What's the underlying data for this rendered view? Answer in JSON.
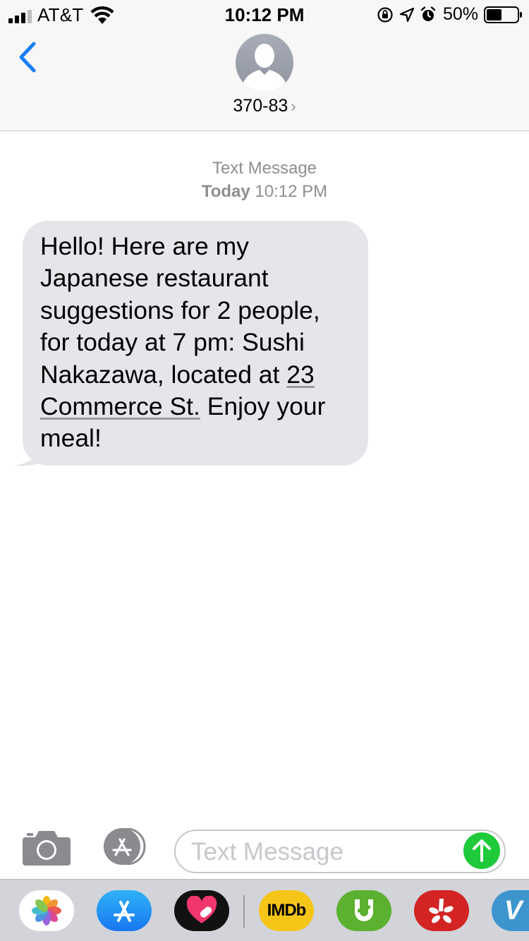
{
  "status_bar": {
    "carrier": "AT&T",
    "time": "10:12 PM",
    "battery_percent": "50%",
    "battery_level": 0.5,
    "icons": [
      "signal-bars-icon",
      "wifi-icon",
      "orientation-lock-icon",
      "location-arrow-icon",
      "alarm-clock-icon",
      "battery-icon"
    ]
  },
  "header": {
    "back_icon": "chevron-left-icon",
    "avatar_icon": "person-silhouette-icon",
    "contact_name": "370-83",
    "contact_chevron": "›"
  },
  "conversation": {
    "service": "Text Message",
    "day": "Today",
    "time": "10:12 PM",
    "messages": [
      {
        "direction": "incoming",
        "text_before": "Hello! Here are my Japanese restaurant suggestions for 2 people, for today at 7 pm: Sushi Nakazawa, located at ",
        "address_link": "23 Commerce St.",
        "text_after": " Enjoy your meal!"
      }
    ]
  },
  "compose": {
    "camera_icon": "camera-icon",
    "apps_icon": "app-store-icon",
    "placeholder": "Text Message",
    "value": "",
    "send_icon": "arrow-up-icon"
  },
  "app_drawer": {
    "apps": [
      {
        "name": "photos",
        "icon": "photos-icon"
      },
      {
        "name": "app-store",
        "icon": "app-store-icon"
      },
      {
        "name": "digital-touch",
        "icon": "heart-touch-icon"
      },
      {
        "name": "imdb",
        "label": "IMDb"
      },
      {
        "name": "u-app",
        "icon": "u-logo-icon"
      },
      {
        "name": "yelp",
        "icon": "yelp-burst-icon"
      },
      {
        "name": "venmo",
        "label": "V"
      }
    ]
  },
  "colors": {
    "accent_blue": "#1a7ef6",
    "bubble_gray": "#e5e5ea",
    "send_green": "#1fca3a",
    "meta_gray": "#8e8e93"
  }
}
